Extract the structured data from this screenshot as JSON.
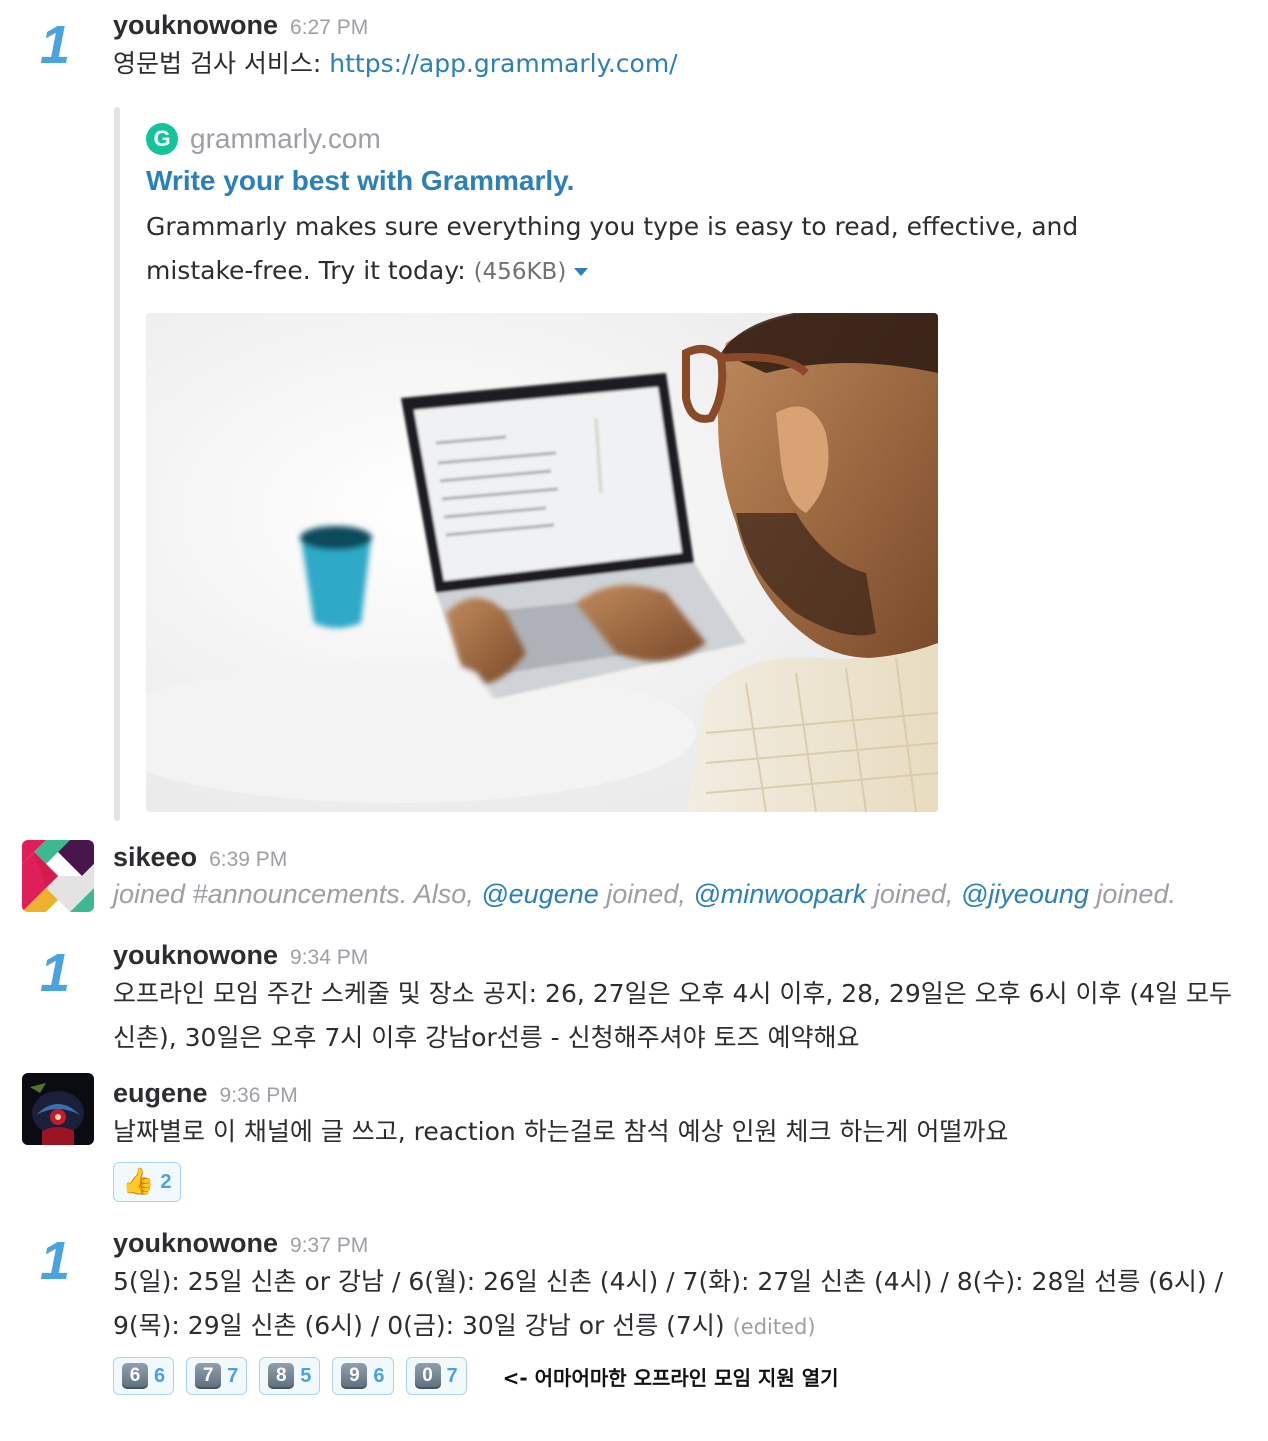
{
  "messages": [
    {
      "avatar": "1",
      "username": "youknowone",
      "time": "6:27 PM",
      "text_prefix": "영문법 검사 서비스: ",
      "link": "https://app.grammarly.com/",
      "attachment": {
        "service_icon": "G",
        "service_name": "grammarly.com",
        "title": "Write your best with Grammarly.",
        "description": "Grammarly makes sure everything you type is easy to read, effective, and mistake-free. Try it today: ",
        "size": "(456KB)",
        "image": "grammarly-laptop-photo"
      }
    },
    {
      "username": "sikeeo",
      "time": "6:39 PM",
      "joined_prefix": "joined #announcements. Also, ",
      "mention_1": "@eugene",
      "joined_1": " joined, ",
      "mention_2": "@minwoopark",
      "joined_2": " joined, ",
      "mention_3": "@jiyeoung",
      "joined_3": " joined."
    },
    {
      "avatar": "1",
      "username": "youknowone",
      "time": "9:34 PM",
      "text": "오프라인 모임 주간 스케줄 및 장소 공지: 26, 27일은 오후 4시 이후, 28, 29일은 오후 6시 이후 (4일 모두 신촌), 30일은 오후 7시 이후 강남or선릉 - 신청해주셔야 토즈 예약해요"
    },
    {
      "username": "eugene",
      "time": "9:36 PM",
      "text": "날짜별로 이 채널에 글 쓰고, reaction 하는걸로 참석 예상 인원 체크 하는게 어떨까요",
      "reactions": [
        {
          "emoji": "👍",
          "count": "2"
        }
      ]
    },
    {
      "avatar": "1",
      "username": "youknowone",
      "time": "9:37 PM",
      "text": "5(일): 25일 신촌 or 강남 / 6(월): 26일 신촌 (4시) / 7(화): 27일 신촌 (4시) / 8(수): 28일 선릉 (6시) / 9(목): 29일 신촌 (6시) /  0(금): 30일 강남 or 선릉 (7시)",
      "edited": "(edited)",
      "reactions": [
        {
          "key": "6",
          "count": "6"
        },
        {
          "key": "7",
          "count": "7"
        },
        {
          "key": "8",
          "count": "5"
        },
        {
          "key": "9",
          "count": "6"
        },
        {
          "key": "0",
          "count": "7"
        }
      ],
      "annotation": "<- 어마어마한 오프라인 모임 지원 열기"
    }
  ]
}
